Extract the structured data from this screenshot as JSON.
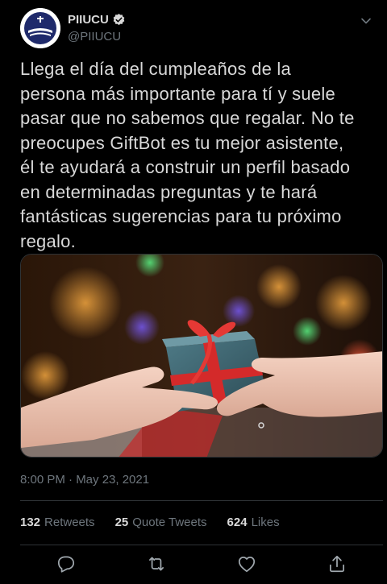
{
  "author": {
    "name": "PIIUCU",
    "handle": "@PIIUCU",
    "avatar_icon": "piiucu-logo-icon",
    "verified_icon": "verified-badge-icon"
  },
  "tweet": {
    "lines": [
      "Llega el día del cumpleaños de la",
      "persona más importante para tí y suele",
      "pasar que no sabemos que regalar. No te",
      "preocupes GiftBot es tu mejor asistente,",
      "él te ayudará a construir un perfil basado",
      "en determinadas preguntas y te hará",
      "fantásticas sugerencias para tu próximo",
      "regalo."
    ],
    "timestamp": "8:00 PM · May 23, 2021"
  },
  "stats": {
    "retweets_count": "132",
    "retweets_label": "Retweets",
    "quotes_count": "25",
    "quotes_label": "Quote Tweets",
    "likes_count": "624",
    "likes_label": "Likes"
  },
  "actions": [
    "reply-icon",
    "retweet-icon",
    "like-icon",
    "share-icon"
  ],
  "colors": {
    "background": "#000000",
    "text": "#d9d9d9",
    "muted": "#6e767d",
    "border": "#2f3336",
    "brand": "#1f2a6b"
  }
}
